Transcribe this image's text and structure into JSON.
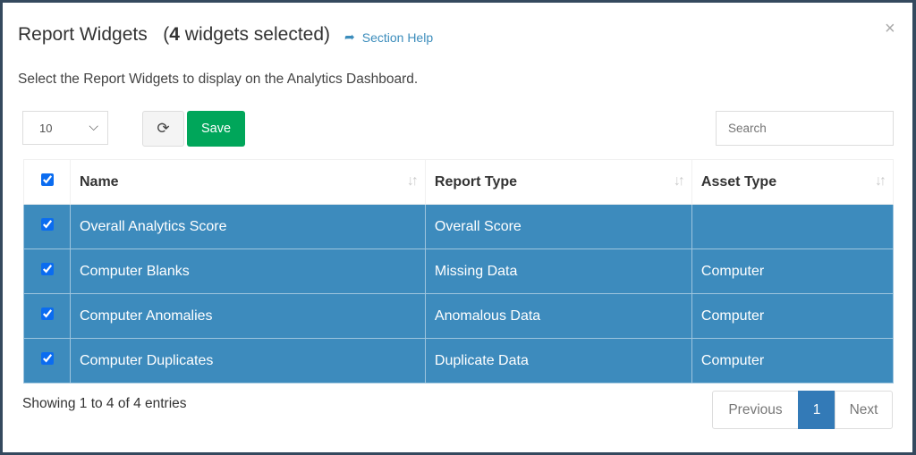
{
  "header": {
    "title": "Report Widgets",
    "count": "4",
    "count_suffix": " widgets selected)",
    "paren_open": "(",
    "help": "Section Help",
    "close": "×"
  },
  "description": "Select the Report Widgets to display on the Analytics Dashboard.",
  "toolbar": {
    "page_length": "10",
    "save_label": "Save",
    "search_placeholder": "Search"
  },
  "table": {
    "columns": [
      "Name",
      "Report Type",
      "Asset Type"
    ],
    "rows": [
      {
        "name": "Overall Analytics Score",
        "report_type": "Overall Score",
        "asset_type": ""
      },
      {
        "name": "Computer Blanks",
        "report_type": "Missing Data",
        "asset_type": "Computer"
      },
      {
        "name": "Computer Anomalies",
        "report_type": "Anomalous Data",
        "asset_type": "Computer"
      },
      {
        "name": "Computer Duplicates",
        "report_type": "Duplicate Data",
        "asset_type": "Computer"
      }
    ]
  },
  "footer": {
    "info": "Showing 1 to 4 of 4 entries",
    "previous": "Previous",
    "page": "1",
    "next": "Next"
  },
  "colors": {
    "selected_row": "#3d8bbd",
    "save": "#00a65a",
    "accent": "#337ab7"
  }
}
